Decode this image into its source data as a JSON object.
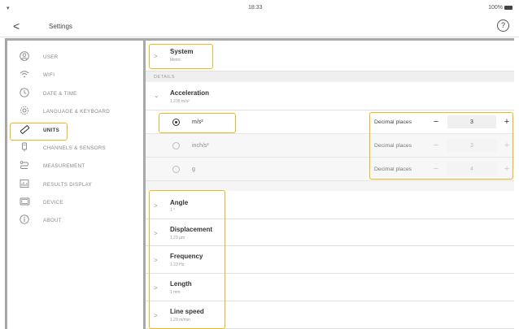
{
  "status": {
    "time": "18:33",
    "battery": "100%"
  },
  "header": {
    "back": "<",
    "title": "Settings",
    "help": "?"
  },
  "sidebar": {
    "items": [
      {
        "label": "USER",
        "icon": "person-icon"
      },
      {
        "label": "WIFI",
        "icon": "wifi-icon"
      },
      {
        "label": "DATE & TIME",
        "icon": "clock-icon"
      },
      {
        "label": "LANGUAGE & KEYBOARD",
        "icon": "gear-icon"
      },
      {
        "label": "UNITS",
        "icon": "ruler-icon"
      },
      {
        "label": "CHANNELS & SENSORS",
        "icon": "sensor-icon"
      },
      {
        "label": "MEASUREMENT",
        "icon": "measurement-icon"
      },
      {
        "label": "RESULTS DISPLAY",
        "icon": "chart-icon"
      },
      {
        "label": "DEVICE",
        "icon": "device-icon"
      },
      {
        "label": "ABOUT",
        "icon": "info-icon"
      }
    ],
    "active": "UNITS"
  },
  "main": {
    "system": {
      "title": "System",
      "subtitle": "Metric"
    },
    "details_label": "DETAILS",
    "acceleration": {
      "title": "Acceleration",
      "subtitle": "1.235 m/s²",
      "options": [
        {
          "unit": "m/s²",
          "selected": true,
          "dp_label": "Decimal places",
          "dp_value": "3"
        },
        {
          "unit": "inch/s²",
          "selected": false,
          "dp_label": "Decimal places",
          "dp_value": "3"
        },
        {
          "unit": "g",
          "selected": false,
          "dp_label": "Decimal places",
          "dp_value": "4"
        }
      ]
    },
    "quantities": [
      {
        "title": "Angle",
        "subtitle": "1 °"
      },
      {
        "title": "Displacement",
        "subtitle": "1.23 µm"
      },
      {
        "title": "Frequency",
        "subtitle": "1.23 Hz"
      },
      {
        "title": "Length",
        "subtitle": "1 mm"
      },
      {
        "title": "Line speed",
        "subtitle": "1.23 m/min"
      }
    ]
  },
  "colors": {
    "highlight": "#f2b61b",
    "frame": "#a8a8a8"
  }
}
